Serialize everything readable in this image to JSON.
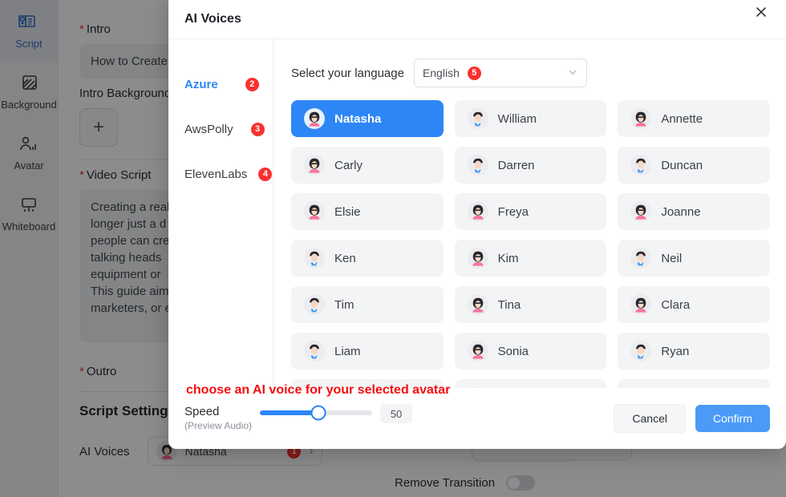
{
  "background": {
    "rail": [
      {
        "label": "Script",
        "icon": "script-icon",
        "active": true
      },
      {
        "label": "Background",
        "icon": "background-icon",
        "active": false
      },
      {
        "label": "Avatar",
        "icon": "avatar-icon",
        "active": false
      },
      {
        "label": "Whiteboard",
        "icon": "whiteboard-icon",
        "active": false
      }
    ],
    "intro_label": "Intro",
    "intro_value": "How to Create",
    "intro_background_label": "Intro Background",
    "add_button": "+",
    "video_script_label": "Video Script",
    "video_script_value": "Creating a real\nlonger just a d\npeople can cre\ntalking heads \nequipment or \nThis guide aim\nmarketers, or e",
    "outro_label": "Outro",
    "script_settings_title": "Script Settings",
    "ai_voices_label": "AI Voices",
    "ai_voices_value": "Natasha",
    "ai_voices_badge": "1",
    "remove_transition_label": "Remove Transition",
    "remove_transition_state": "off"
  },
  "modal": {
    "title": "AI Voices",
    "close_label": "×",
    "tabs": [
      {
        "label": "Azure",
        "badge": "2",
        "active": true
      },
      {
        "label": "AwsPolly",
        "badge": "3",
        "active": false
      },
      {
        "label": "ElevenLabs",
        "badge": "4",
        "active": false
      }
    ],
    "language_label": "Select your language",
    "language_value": "English",
    "language_badge": "5",
    "voices": [
      {
        "name": "Natasha",
        "gender": "female",
        "selected": true
      },
      {
        "name": "William",
        "gender": "male",
        "selected": false
      },
      {
        "name": "Annette",
        "gender": "female",
        "selected": false
      },
      {
        "name": "Carly",
        "gender": "female",
        "selected": false
      },
      {
        "name": "Darren",
        "gender": "male",
        "selected": false
      },
      {
        "name": "Duncan",
        "gender": "male",
        "selected": false
      },
      {
        "name": "Elsie",
        "gender": "female",
        "selected": false
      },
      {
        "name": "Freya",
        "gender": "female",
        "selected": false
      },
      {
        "name": "Joanne",
        "gender": "female",
        "selected": false
      },
      {
        "name": "Ken",
        "gender": "male",
        "selected": false
      },
      {
        "name": "Kim",
        "gender": "female",
        "selected": false
      },
      {
        "name": "Neil",
        "gender": "male",
        "selected": false
      },
      {
        "name": "Tim",
        "gender": "male",
        "selected": false
      },
      {
        "name": "Tina",
        "gender": "female",
        "selected": false
      },
      {
        "name": "Clara",
        "gender": "female",
        "selected": false
      },
      {
        "name": "Liam",
        "gender": "male",
        "selected": false
      },
      {
        "name": "Sonia",
        "gender": "female",
        "selected": false
      },
      {
        "name": "Ryan",
        "gender": "male",
        "selected": false
      },
      {
        "name": "",
        "gender": "male",
        "selected": false
      },
      {
        "name": "",
        "gender": "female",
        "selected": false
      },
      {
        "name": "",
        "gender": "male",
        "selected": false
      }
    ],
    "speed_label": "Speed",
    "speed_sublabel": "(Preview Audio)",
    "speed_value": "50",
    "cancel_label": "Cancel",
    "confirm_label": "Confirm"
  },
  "annotation": {
    "text": "choose an AI voice for your selected avatar",
    "color": "#f40d0d"
  },
  "colors": {
    "accent": "#2d86f5",
    "confirm": "#4c9af7",
    "badge_red": "#f8312f",
    "annotation_red": "#f40d0d",
    "card_bg": "#f3f4f6"
  }
}
